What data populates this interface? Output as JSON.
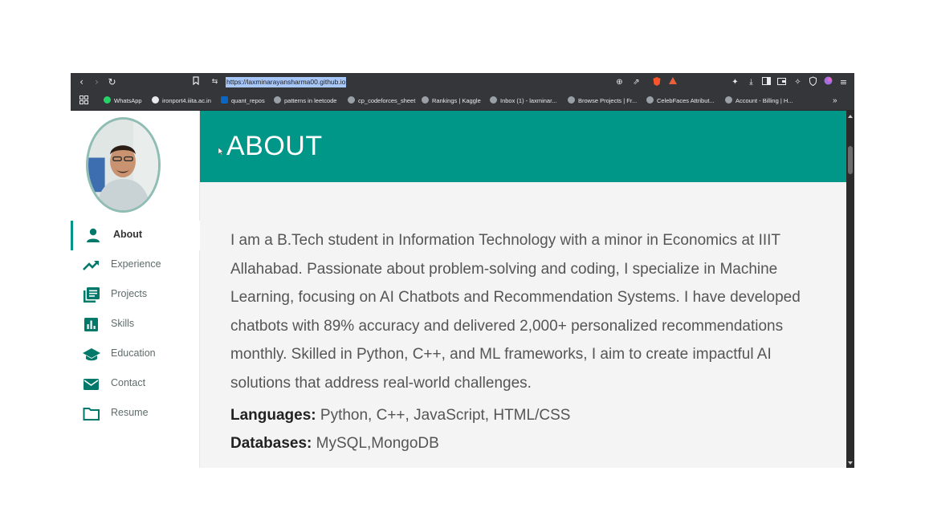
{
  "browser": {
    "url": "https://laxminarayansharma00.github.io",
    "bookmarks": [
      {
        "label": "WhatsApp"
      },
      {
        "label": "ironport4.iiita.ac.in"
      },
      {
        "label": "quant_repos"
      },
      {
        "label": "patterns in leetcode"
      },
      {
        "label": "cp_codeforces_sheet"
      },
      {
        "label": "Rankings | Kaggle"
      },
      {
        "label": "Inbox (1) - laxminar..."
      },
      {
        "label": "Browse Projects | Fr..."
      },
      {
        "label": "CelebFaces Attribut..."
      },
      {
        "label": "Account - Billing | H..."
      }
    ],
    "more_label": "»"
  },
  "sidebar": {
    "items": [
      {
        "label": "About",
        "icon": "person-icon",
        "active": true
      },
      {
        "label": "Experience",
        "icon": "trending-up-icon"
      },
      {
        "label": "Projects",
        "icon": "list-icon"
      },
      {
        "label": "Skills",
        "icon": "bar-chart-icon"
      },
      {
        "label": "Education",
        "icon": "school-icon"
      },
      {
        "label": "Contact",
        "icon": "mail-icon"
      },
      {
        "label": "Resume",
        "icon": "folder-icon"
      }
    ]
  },
  "header": {
    "title": "ABOUT"
  },
  "about": {
    "paragraph": "I am a B.Tech student in Information Technology with a minor in Economics at IIIT Allahabad. Passionate about problem-solving and coding, I specialize in Machine Learning, focusing on AI Chatbots and Recommendation Systems. I have developed chatbots with 89% accuracy and delivered 2,000+ personalized recommendations monthly. Skilled in Python, C++, and ML frameworks, I aim to create impactful AI solutions that address real-world challenges.",
    "languages_label": "Languages:",
    "languages_value": " Python, C++, JavaScript, HTML/CSS",
    "databases_label": "Databases:",
    "databases_value": " MySQL,MongoDB"
  },
  "colors": {
    "accent": "#009688",
    "sidebar_icon": "#00796b",
    "chrome": "#35363a"
  }
}
